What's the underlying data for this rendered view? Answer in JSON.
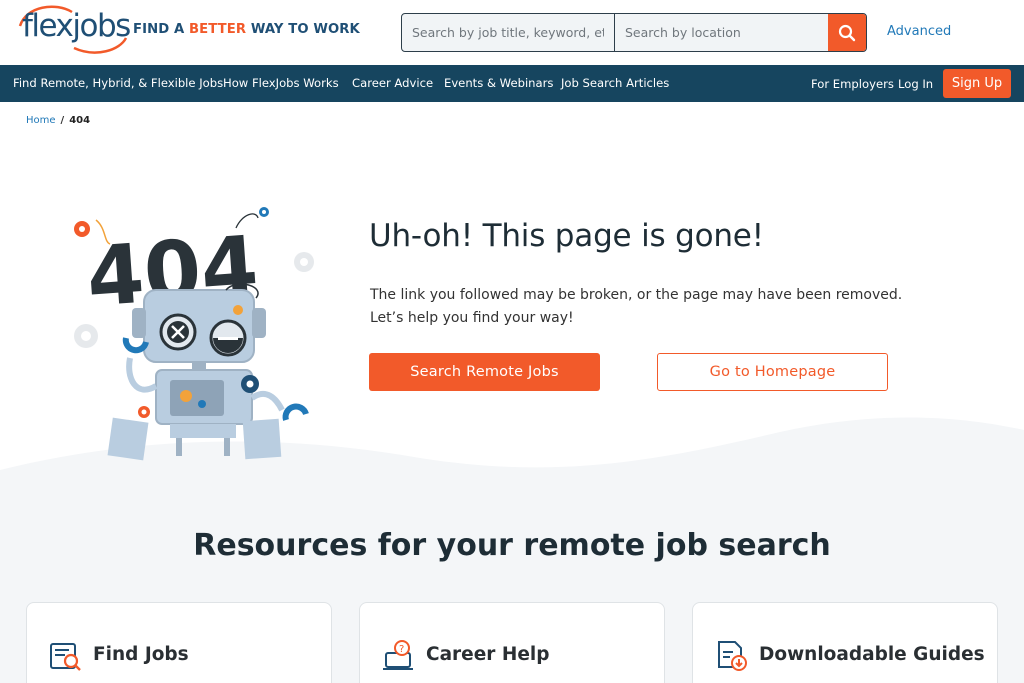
{
  "header": {
    "logo_text": "flexjobs",
    "tagline_part1": "FIND A ",
    "tagline_part2": "BETTER",
    "tagline_part3": " WAY TO WORK",
    "search_keyword_placeholder": "Search by job title, keyword, etc.",
    "search_location_placeholder": "Search by location",
    "advanced_label": "Advanced"
  },
  "nav": {
    "items": [
      "Find Remote, Hybrid, & Flexible Jobs",
      "How FlexJobs Works",
      "Career Advice",
      "Events & Webinars",
      "Job Search Articles"
    ],
    "for_employers": "For Employers",
    "login": "Log In",
    "signup": "Sign Up"
  },
  "breadcrumb": {
    "home": "Home",
    "separator": "/",
    "current": "404"
  },
  "hero": {
    "headline": "Uh-oh! This page is gone!",
    "subtext": "The link you followed may be broken, or the page may have been removed. Let’s help you find your way!",
    "primary_button": "Search Remote Jobs",
    "secondary_button": "Go to Homepage",
    "illustration_text": "404"
  },
  "resources": {
    "title": "Resources for your remote job search",
    "cards": [
      {
        "label": "Find Jobs",
        "icon": "job-search-icon"
      },
      {
        "label": "Career Help",
        "icon": "career-help-icon"
      },
      {
        "label": "Downloadable Guides",
        "icon": "download-guide-icon"
      }
    ]
  },
  "colors": {
    "brand_navy": "#16455f",
    "accent_orange": "#f25a2a",
    "link_blue": "#2179b8"
  }
}
